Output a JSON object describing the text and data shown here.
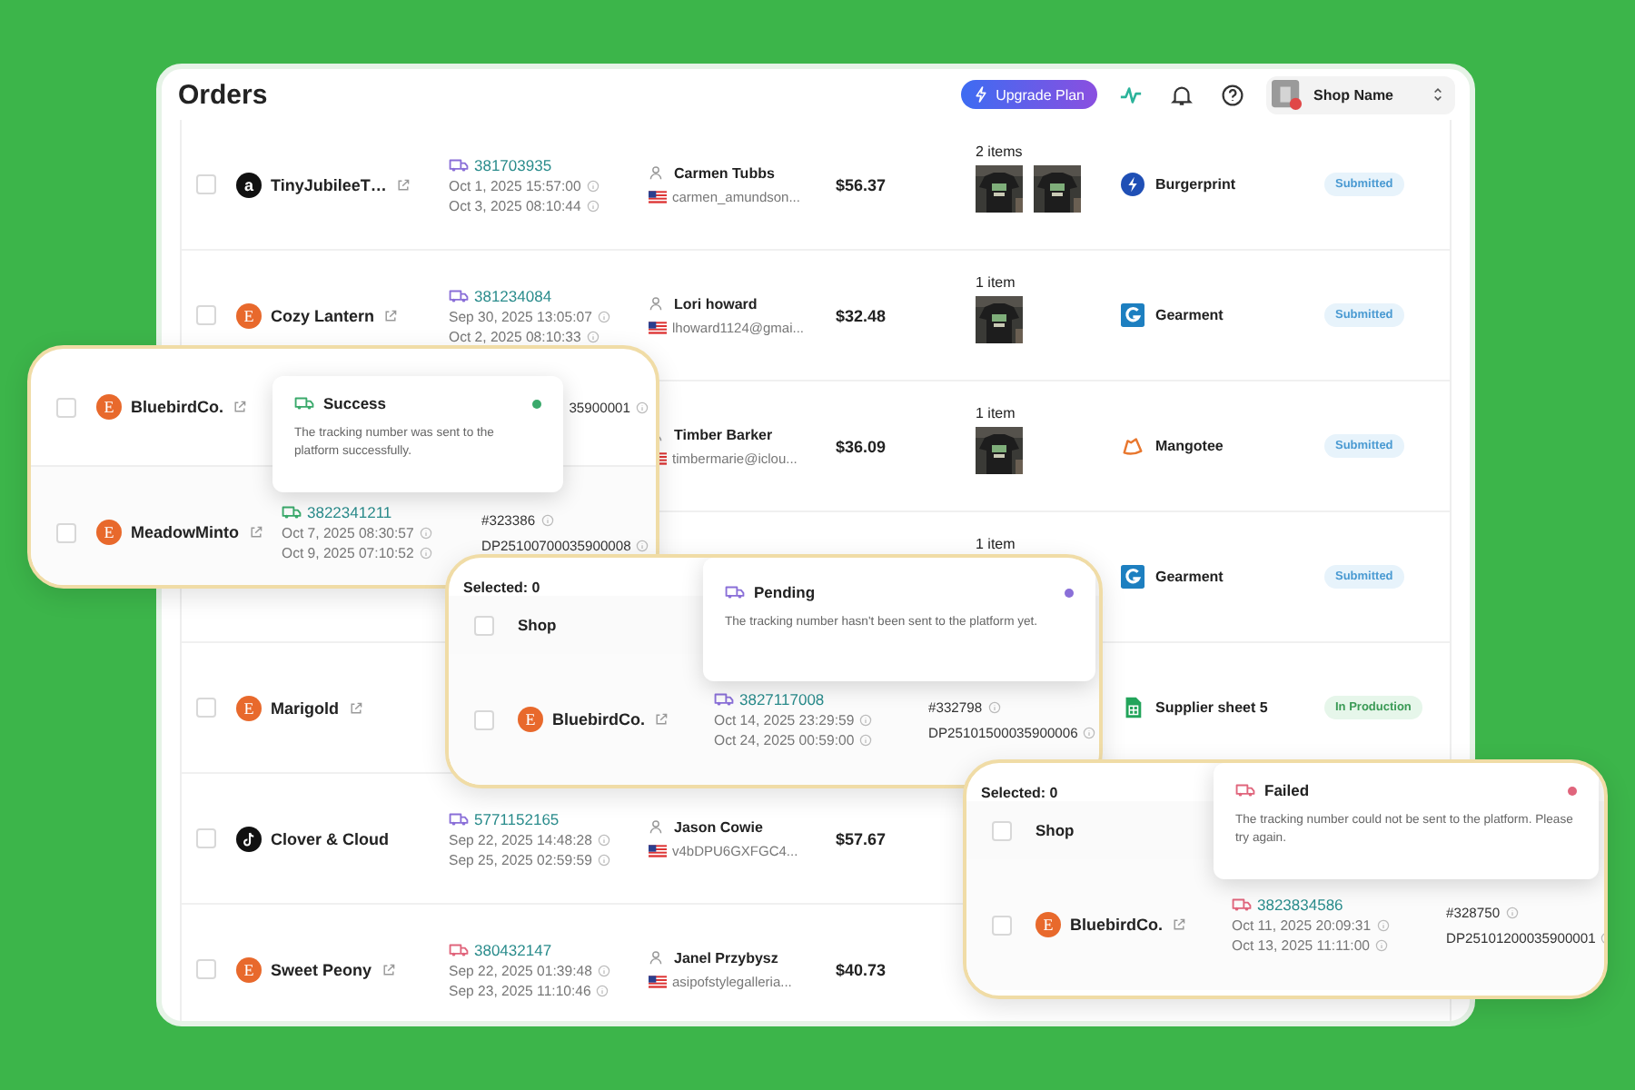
{
  "header": {
    "title": "Orders",
    "upgrade_label": "Upgrade Plan",
    "shop_name": "Shop Name"
  },
  "orders": [
    {
      "checked": false,
      "shop": {
        "name": "TinyJubileeT…",
        "kind": "amazon",
        "badge": "a",
        "link": true
      },
      "tracking": {
        "number": "381703935",
        "kind": "pending",
        "created": "Oct 1, 2025 15:57:00",
        "due": "Oct 3, 2025 08:10:44"
      },
      "customer": {
        "name": "Carmen Tubbs",
        "email": "carmen_amundson..."
      },
      "total": "$56.37",
      "items": {
        "label": "2 items"
      },
      "supplier": {
        "name": "Burgerprint",
        "kind": "burgerprint"
      },
      "status": {
        "label": "Submitted",
        "kind": "submitted"
      }
    },
    {
      "checked": false,
      "shop": {
        "name": "Cozy Lantern",
        "kind": "etsy",
        "badge": "E",
        "link": true
      },
      "tracking": {
        "number": "381234084",
        "kind": "pending",
        "created": "Sep 30, 2025 13:05:07",
        "due": "Oct 2, 2025 08:10:33"
      },
      "customer": {
        "name": "Lori howard",
        "email": "lhoward1124@gmai..."
      },
      "total": "$32.48",
      "items": {
        "label": "1 item"
      },
      "supplier": {
        "name": "Gearment",
        "kind": "gearment"
      },
      "status": {
        "label": "Submitted",
        "kind": "submitted"
      }
    },
    {
      "customer": {
        "name": "Timber Barker",
        "email": "timbermarie@iclou..."
      },
      "total": "$36.09",
      "items": {
        "label": "1 item"
      },
      "supplier": {
        "name": "Mangotee",
        "kind": "mangotee"
      },
      "status": {
        "label": "Submitted",
        "kind": "submitted"
      }
    },
    {
      "items": {
        "label": "1 item"
      },
      "supplier": {
        "name": "Gearment",
        "kind": "gearment"
      },
      "status": {
        "label": "Submitted",
        "kind": "submitted"
      }
    },
    {
      "checked": false,
      "shop": {
        "name": "Marigold",
        "kind": "etsy",
        "badge": "E",
        "link": true
      },
      "supplier": {
        "name": "Supplier sheet 5",
        "kind": "sheet"
      },
      "status": {
        "label": "In Production",
        "kind": "production"
      }
    },
    {
      "checked": false,
      "shop": {
        "name": "Clover & Cloud",
        "kind": "tiktok",
        "link": false
      },
      "tracking": {
        "number": "5771152165",
        "kind": "pending",
        "created": "Sep 22, 2025 14:48:28",
        "due": "Sep 25, 2025 02:59:59"
      },
      "customer": {
        "name": "Jason Cowie",
        "email": "v4bDPU6GXFGC4..."
      },
      "total": "$57.67"
    },
    {
      "checked": false,
      "shop": {
        "name": "Sweet Peony",
        "kind": "etsy",
        "badge": "E",
        "link": true
      },
      "tracking": {
        "number": "380432147",
        "kind": "failed",
        "created": "Sep 22, 2025 01:39:48",
        "due": "Sep 23, 2025 11:10:46"
      },
      "customer": {
        "name": "Janel Przybysz",
        "email": "asipofstylegalleria..."
      },
      "total": "$40.73"
    }
  ],
  "cards": [
    {
      "tooltip": {
        "kind": "success",
        "title": "Success",
        "text": "The tracking number was sent to the platform successfully."
      },
      "rows": [
        {
          "checked": false,
          "shop": {
            "name": "BluebirdCo.",
            "kind": "etsy",
            "badge": "E",
            "link": true
          },
          "refs": [
            "35900001"
          ]
        },
        {
          "checked": false,
          "shop": {
            "name": "MeadowMinto",
            "kind": "etsy",
            "badge": "E",
            "link": true
          },
          "tracking": {
            "number": "3822341211",
            "kind": "success",
            "created": "Oct 7, 2025 08:30:57",
            "due": "Oct 9, 2025 07:10:52"
          },
          "refs": [
            "#323386",
            "DP25100700035900008"
          ]
        }
      ]
    },
    {
      "selected_label": "Selected: 0",
      "header": {
        "checked": false,
        "label": "Shop"
      },
      "tooltip": {
        "kind": "pending",
        "title": "Pending",
        "text": "The tracking number hasn't been sent to the platform yet."
      },
      "rows": [
        {
          "checked": false,
          "shop": {
            "name": "BluebirdCo.",
            "kind": "etsy",
            "badge": "E",
            "link": true
          },
          "tracking": {
            "number": "3827117008",
            "kind": "pending",
            "created": "Oct 14, 2025 23:29:59",
            "due": "Oct 24, 2025 00:59:00"
          },
          "refs": [
            "#332798",
            "DP25101500035900006"
          ]
        }
      ]
    },
    {
      "selected_label": "Selected: 0",
      "header": {
        "checked": false,
        "label": "Shop"
      },
      "tooltip": {
        "kind": "failed",
        "title": "Failed",
        "text": "The tracking number could not be sent to the platform. Please try again."
      },
      "rows": [
        {
          "checked": false,
          "shop": {
            "name": "BluebirdCo.",
            "kind": "etsy",
            "badge": "E",
            "link": true
          },
          "tracking": {
            "number": "3823834586",
            "kind": "failed",
            "created": "Oct 11, 2025 20:09:31",
            "due": "Oct 13, 2025 11:11:00"
          },
          "refs": [
            "#328750",
            "DP25101200035900001"
          ]
        }
      ]
    }
  ]
}
